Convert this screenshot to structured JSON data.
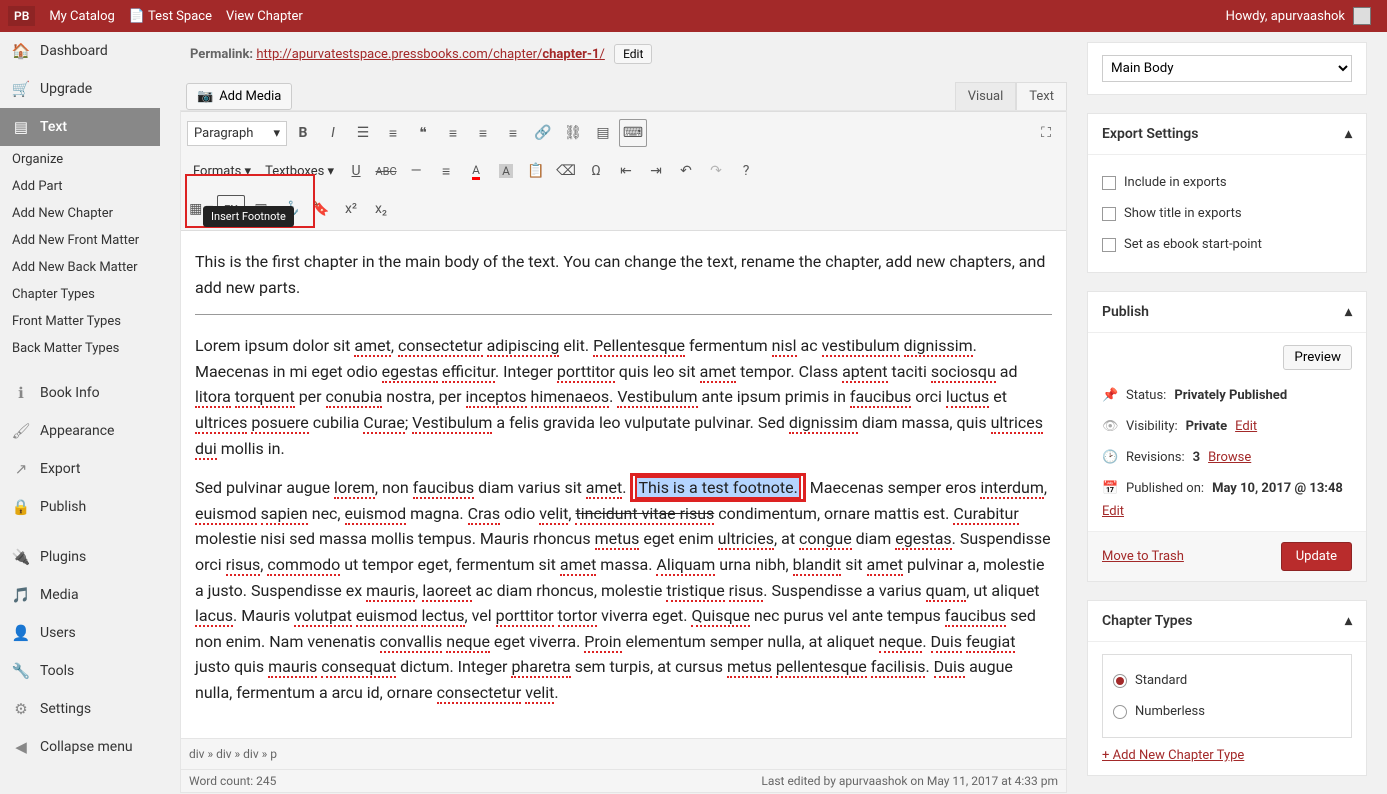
{
  "topbar": {
    "logo": "PB",
    "my_catalog": "My Catalog",
    "test_space": "Test Space",
    "view_chapter": "View Chapter",
    "howdy": "Howdy, apurvaashok"
  },
  "sidebar": {
    "dashboard": "Dashboard",
    "upgrade": "Upgrade",
    "text": "Text",
    "organize": "Organize",
    "add_part": "Add Part",
    "add_chapter": "Add New Chapter",
    "add_front": "Add New Front Matter",
    "add_back": "Add New Back Matter",
    "chapter_types": "Chapter Types",
    "front_types": "Front Matter Types",
    "back_types": "Back Matter Types",
    "book_info": "Book Info",
    "appearance": "Appearance",
    "export": "Export",
    "publish": "Publish",
    "plugins": "Plugins",
    "media": "Media",
    "users": "Users",
    "tools": "Tools",
    "settings": "Settings",
    "collapse": "Collapse menu"
  },
  "permalink": {
    "label": "Permalink:",
    "base": "http://apurvatestspace.pressbooks.com/chapter/",
    "slug": "chapter-1",
    "trail": "/",
    "edit": "Edit"
  },
  "editor": {
    "add_media": "Add Media",
    "tab_visual": "Visual",
    "tab_text": "Text",
    "format_select": "Paragraph",
    "formats_menu": "Formats",
    "textboxes_menu": "Textboxes",
    "fn_label": "FN",
    "tooltip": "Insert Footnote",
    "p1": "This is the first chapter in the main body of the text. You can change the text, rename the chapter, add new chapters, and add new parts.",
    "selected": "This is a test footnote.",
    "path": "div » div » div » p",
    "wordcount": "Word count: 245",
    "last_edited": "Last edited by apurvaashok on May 11, 2017 at 4:33 pm"
  },
  "template": {
    "selected": "Main Body"
  },
  "export": {
    "title": "Export Settings",
    "include": "Include in exports",
    "show_title": "Show title in exports",
    "ebook_start": "Set as ebook start-point"
  },
  "publish": {
    "title": "Publish",
    "preview": "Preview",
    "status_label": "Status:",
    "status_value": "Privately Published",
    "visibility_label": "Visibility:",
    "visibility_value": "Private",
    "edit": "Edit",
    "revisions_label": "Revisions:",
    "revisions_count": "3",
    "browse": "Browse",
    "published_on_label": "Published on:",
    "published_on_value": "May 10, 2017 @ 13:48",
    "trash": "Move to Trash",
    "update": "Update"
  },
  "chapter_types": {
    "title": "Chapter Types",
    "standard": "Standard",
    "numberless": "Numberless",
    "add_new": "+ Add New Chapter Type"
  }
}
